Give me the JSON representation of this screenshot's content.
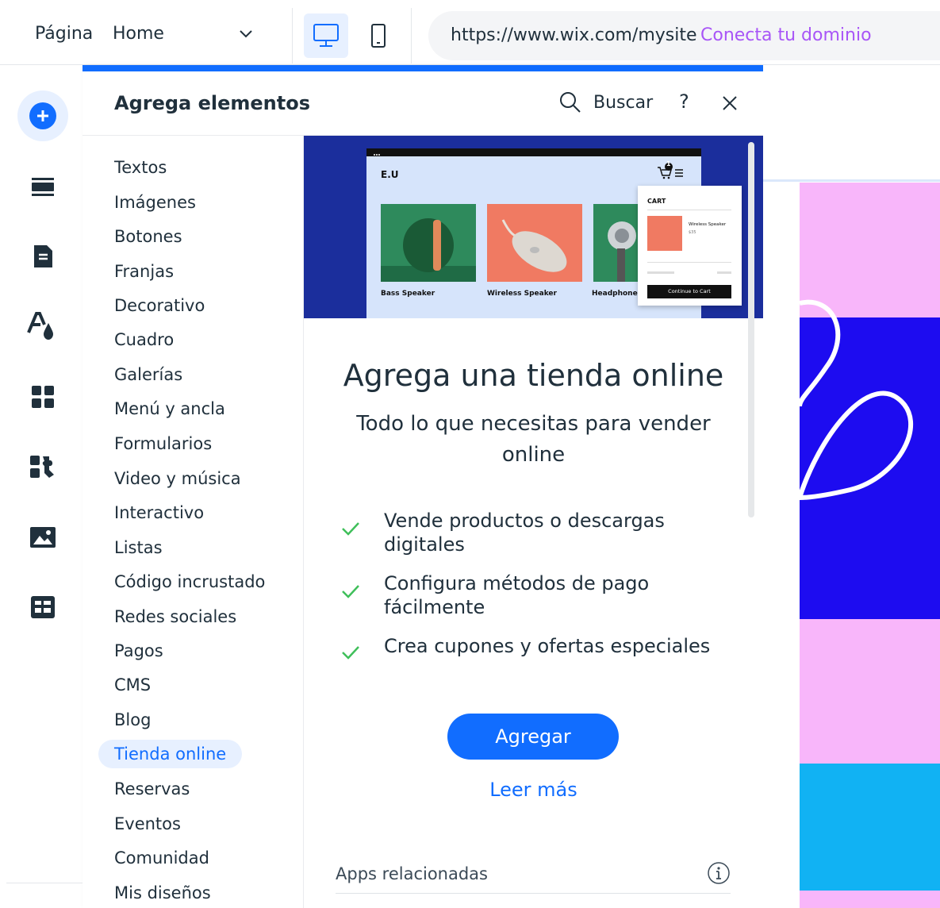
{
  "topbar": {
    "page_label": "Página",
    "page_value": "Home",
    "url": "https://www.wix.com/mysite",
    "connect_domain": "Conecta tu dominio"
  },
  "panel": {
    "title": "Agrega elementos",
    "search_label": "Buscar",
    "help": "?",
    "categories": [
      "Textos",
      "Imágenes",
      "Botones",
      "Franjas",
      "Decorativo",
      "Cuadro",
      "Galerías",
      "Menú y ancla",
      "Formularios",
      "Video y música",
      "Interactivo",
      "Listas",
      "Código incrustado",
      "Redes sociales",
      "Pagos",
      "CMS",
      "Blog",
      "Tienda online",
      "Reservas",
      "Eventos",
      "Comunidad",
      "Mis diseños"
    ],
    "active_category": "Tienda online"
  },
  "mock_store": {
    "brand": "E.U",
    "cart_count": "1",
    "products": [
      "Bass Speaker",
      "Wireless Speaker",
      "Headphones"
    ],
    "cart_title": "CART",
    "cart_item": "Wireless Speaker",
    "cart_price": "$35",
    "cart_button": "Continue to Cart"
  },
  "promo": {
    "title": "Agrega una tienda online",
    "subtitle": "Todo lo que necesitas para vender online",
    "features": [
      "Vende productos o descargas digitales",
      "Configura métodos de pago fácilmente",
      "Crea cupones y ofertas especiales"
    ],
    "add_button": "Agregar",
    "learn_more": "Leer más",
    "related_apps": "Apps relacionadas"
  },
  "colors": {
    "accent": "#116dff",
    "connect": "#a855f7",
    "hero_bg": "#1b2e9c",
    "check": "#3fbf5a",
    "art_pink": "#f8b6fa",
    "art_blue": "#1d0cf0",
    "art_cyan": "#11b2f3"
  },
  "icons": {
    "sidebar": [
      "add-icon",
      "sections-icon",
      "pages-icon",
      "design-icon",
      "apps-icon",
      "business-apps-icon",
      "media-icon",
      "cms-icon"
    ]
  }
}
